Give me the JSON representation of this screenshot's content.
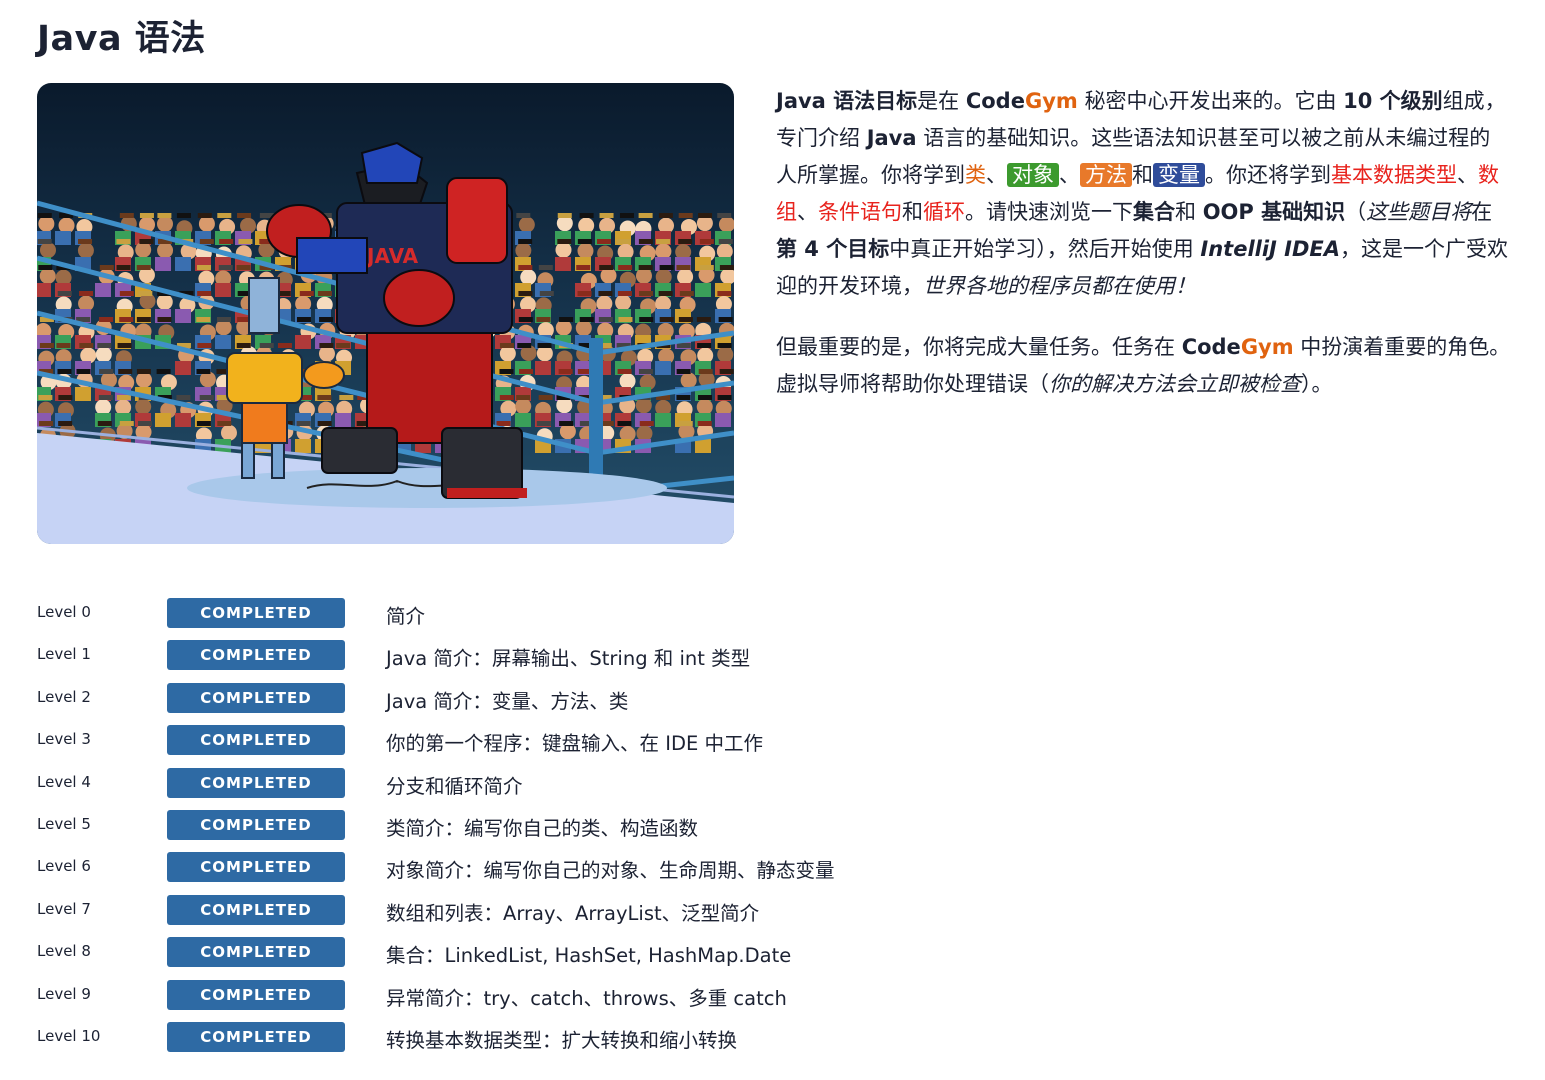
{
  "page": {
    "title": "Java 语法"
  },
  "hero": {
    "sign_text": "JAVA"
  },
  "description": {
    "p1": [
      {
        "t": "Java 语法目标",
        "c": "b"
      },
      {
        "t": "是在 "
      },
      {
        "t": "Code",
        "c": "b"
      },
      {
        "t": "Gym",
        "c": "b orange"
      },
      {
        "t": " 秘密中心开发出来的。它由 "
      },
      {
        "t": "10 个级别",
        "c": "b"
      },
      {
        "t": "组成，专门介绍 "
      },
      {
        "t": "Java",
        "c": "b"
      },
      {
        "t": " 语言的基础知识。这些语法知识甚至可以被之前从未编过程的人所掌握。你将学到"
      },
      {
        "t": "类",
        "c": "orange"
      },
      {
        "t": "、"
      },
      {
        "t": "对象",
        "c": "hl hl-green"
      },
      {
        "t": "、"
      },
      {
        "t": "方法",
        "c": "hl hl-orange"
      },
      {
        "t": "和"
      },
      {
        "t": "变量",
        "c": "hl hl-blue"
      },
      {
        "t": "。你还将学到"
      },
      {
        "t": "基本数据类型",
        "c": "red"
      },
      {
        "t": "、"
      },
      {
        "t": "数组",
        "c": "red"
      },
      {
        "t": "、"
      },
      {
        "t": "条件语句",
        "c": "red"
      },
      {
        "t": "和"
      },
      {
        "t": "循环",
        "c": "red"
      },
      {
        "t": "。请快速浏览一下"
      },
      {
        "t": "集合",
        "c": "b"
      },
      {
        "t": "和 "
      },
      {
        "t": "OOP 基础知识",
        "c": "b"
      },
      {
        "t": "（"
      },
      {
        "t": "这些题目将",
        "c": "i"
      },
      {
        "t": "在"
      },
      {
        "t": "第 4 个目标",
        "c": "b"
      },
      {
        "t": "中真正开始学习），然后开始使用 "
      },
      {
        "t": "IntelliJ IDEA",
        "c": "b i"
      },
      {
        "t": "，这是一个广受欢迎的开发环境，"
      },
      {
        "t": "世界各地的程序员都在使用！",
        "c": "i"
      }
    ],
    "p2": [
      {
        "t": "但最重要的是，你将完成大量任务。任务在 "
      },
      {
        "t": "Code",
        "c": "b"
      },
      {
        "t": "Gym",
        "c": "b orange"
      },
      {
        "t": " 中扮演着重要的角色。虚拟导师将帮助你处理错误（"
      },
      {
        "t": "你的解决方法会立即被检查",
        "c": "i"
      },
      {
        "t": "）。"
      }
    ]
  },
  "levels": [
    {
      "label": "Level 0",
      "status": "COMPLETED",
      "title": "简介"
    },
    {
      "label": "Level 1",
      "status": "COMPLETED",
      "title": "Java 简介：屏幕输出、String 和 int 类型"
    },
    {
      "label": "Level 2",
      "status": "COMPLETED",
      "title": "Java 简介：变量、方法、类"
    },
    {
      "label": "Level 3",
      "status": "COMPLETED",
      "title": "你的第一个程序：键盘输入、在 IDE 中工作"
    },
    {
      "label": "Level 4",
      "status": "COMPLETED",
      "title": "分支和循环简介"
    },
    {
      "label": "Level 5",
      "status": "COMPLETED",
      "title": "类简介：编写你自己的类、构造函数"
    },
    {
      "label": "Level 6",
      "status": "COMPLETED",
      "title": "对象简介：编写你自己的对象、生命周期、静态变量"
    },
    {
      "label": "Level 7",
      "status": "COMPLETED",
      "title": "数组和列表：Array、ArrayList、泛型简介"
    },
    {
      "label": "Level 8",
      "status": "COMPLETED",
      "title": "集合：LinkedList, HashSet, HashMap.Date"
    },
    {
      "label": "Level 9",
      "status": "COMPLETED",
      "title": "异常简介：try、catch、throws、多重 catch"
    },
    {
      "label": "Level 10",
      "status": "COMPLETED",
      "title": "转换基本数据类型：扩大转换和缩小转换"
    }
  ]
}
